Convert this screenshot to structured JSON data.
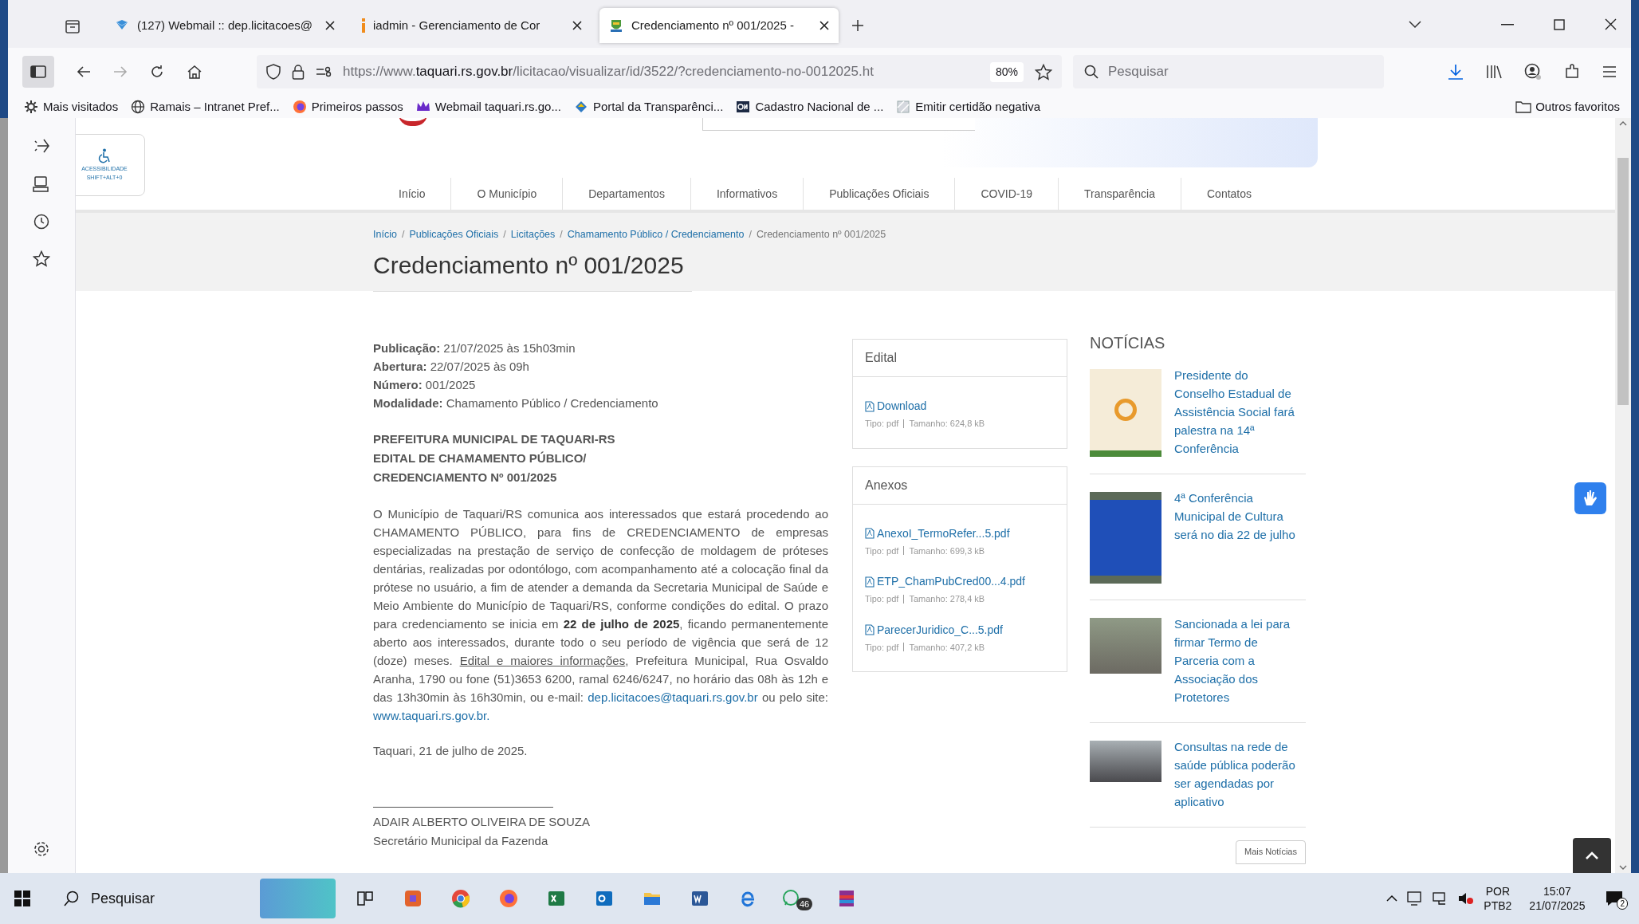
{
  "browser": {
    "tabs": [
      {
        "label": "(127) Webmail :: dep.licitacoes@",
        "selected": false
      },
      {
        "label": "iadmin - Gerenciamento de Cor",
        "selected": false
      },
      {
        "label": "Credenciamento nº 001/2025 -",
        "selected": true
      }
    ],
    "address": {
      "prefix": "https://www.",
      "host": "taquari.rs.gov.br",
      "path": "/licitacao/visualizar/id/3522/?credenciamento-no-0012025.ht",
      "zoom": "80%"
    },
    "search": {
      "placeholder": "Pesquisar"
    },
    "bookmarks": [
      "Mais visitados",
      "Ramais – Intranet Pref...",
      "Primeiros passos",
      "Webmail taquari.rs.go...",
      "Portal da Transparênci...",
      "Cadastro Nacional de ...",
      "Emitir certidão negativa"
    ],
    "other_bookmarks": "Outros favoritos"
  },
  "site": {
    "accessibility": {
      "title": "ACESSIBILIDADE",
      "shortcut": "SHIFT+ALT+0"
    },
    "nav": [
      "Início",
      "O Município",
      "Departamentos",
      "Informativos",
      "Publicações Oficiais",
      "COVID-19",
      "Transparência",
      "Contatos"
    ],
    "breadcrumb_separators": [
      "/",
      "/",
      "/",
      "/"
    ],
    "breadcrumb": [
      "Início",
      "Publicações Oficiais",
      "Licitações",
      "Chamamento Público / Credenciamento",
      "Credenciamento nº 001/2025"
    ],
    "title": "Credenciamento nº 001/2025",
    "meta": [
      "**Publicação:** 21/07/2025 às 15h03min",
      "**Abertura:** 22/07/2025 às 09h",
      "**Número:** 001/2025",
      "**Modalidade:** Chamamento Público / Credenciamento"
    ],
    "heading_lines": [
      "PREFEITURA MUNICIPAL DE TAQUARI-RS",
      "EDITAL DE CHAMAMENTO PÚBLICO/",
      "CREDENCIAMENTO Nº 001/2025"
    ],
    "body": [
      {
        "kind": "text",
        "text": " O Município de Taquari/RS comunica aos interessados que estará procedendo ao CHAMAMENTO PÚBLICO, para fins de CREDENCIAMENTO de empresas especializadas na prestação de serviço de confecção de moldagem de próteses dentárias, realizadas por odontólogo, com acompanhamento até a colocação final da prótese no usuário, a fim de atender a demanda da Secretaria Municipal de Saúde e Meio Ambiente do Município de Taquari/RS, conforme condições do edital. O prazo para credenciamento se inicia em "
      },
      {
        "kind": "bold",
        "text": "22 de julho de 2025"
      },
      {
        "kind": "text",
        "text": ", ficando permanentemente aberto aos interessados, durante todo o seu período de vigência que será de 12 (doze) meses. "
      },
      {
        "kind": "underline",
        "text": "Edital e maiores informações"
      },
      {
        "kind": "text",
        "text": ", Prefeitura Municipal, Rua Osvaldo Aranha, 1790 ou fone (51)3653 6200, ramal 6246/6247, no horário das 08h às 12h e das 13h30min às 16h30min, ou e-mail: "
      },
      {
        "kind": "link",
        "text": "dep.licitacoes@taquari.rs.gov.br"
      },
      {
        "kind": "text",
        "text": " ou pelo site: "
      },
      {
        "kind": "link",
        "text": "www.taquari.rs.gov.br."
      }
    ],
    "date_line": "Taquari, 21  de julho de 2025.",
    "signature": {
      "name": "ADAIR ALBERTO OLIVEIRA DE SOUZA",
      "role": "Secretário Municipal da Fazenda"
    },
    "edital": {
      "title": "Edital",
      "files": [
        {
          "name": "Download",
          "type": "Tipo: pdf",
          "size": "Tamanho: 624,8 kB"
        }
      ]
    },
    "anexos": {
      "title": "Anexos",
      "files": [
        {
          "name": "AnexoI_TermoRefer...5.pdf",
          "type": "Tipo: pdf",
          "size": "Tamanho: 699,3 kB"
        },
        {
          "name": "ETP_ChamPubCred00...4.pdf",
          "type": "Tipo: pdf",
          "size": "Tamanho: 278,4 kB"
        },
        {
          "name": "ParecerJuridico_C...5.pdf",
          "type": "Tipo: pdf",
          "size": "Tamanho: 407,2 kB"
        }
      ]
    },
    "news": {
      "title": "NOTÍCIAS",
      "items": [
        "Presidente do Conselho Estadual de Assistência Social fará palestra na 14ª Conferência",
        "4ª Conferência Municipal de Cultura será no dia 22 de julho",
        "Sancionada a lei para firmar Termo de Parceria com a Associação dos Protetores",
        "Consultas na rede de saúde pública poderão ser agendadas por aplicativo"
      ],
      "more": "Mais Notícias"
    }
  },
  "taskbar": {
    "search": "Pesquisar",
    "chat_badge": "46",
    "lang": "POR",
    "layout": "PTB2",
    "time": "15:07",
    "date": "21/07/2025",
    "notifications": "2"
  }
}
